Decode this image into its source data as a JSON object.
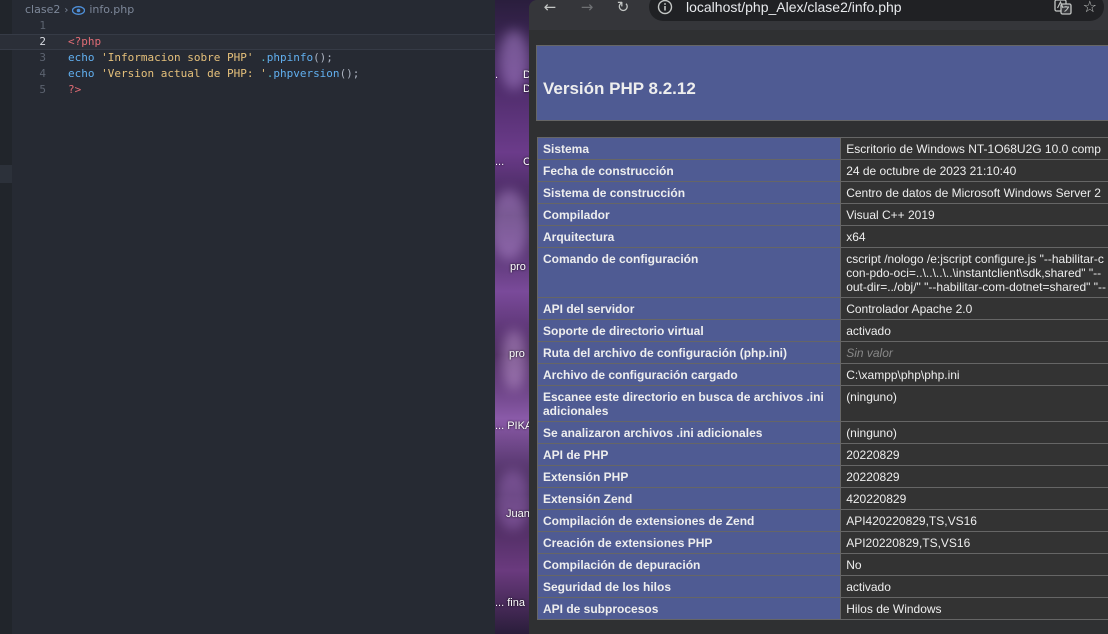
{
  "editor": {
    "breadcrumb": {
      "folder": "clase2",
      "file": "info.php"
    },
    "lines": [
      {
        "num": "1",
        "tokens": []
      },
      {
        "num": "2",
        "tokens": [
          {
            "cls": "tag",
            "t": "<?php"
          }
        ]
      },
      {
        "num": "3",
        "tokens": [
          {
            "cls": "kw",
            "t": "echo "
          },
          {
            "cls": "str",
            "t": "'Informacion sobre PHP'"
          },
          {
            "cls": "op",
            "t": " ."
          },
          {
            "cls": "fn",
            "t": "phpinfo"
          },
          {
            "cls": "punc",
            "t": "();"
          }
        ]
      },
      {
        "num": "4",
        "tokens": [
          {
            "cls": "kw",
            "t": "echo "
          },
          {
            "cls": "str",
            "t": "'Version actual de PHP: '"
          },
          {
            "cls": "op",
            "t": "."
          },
          {
            "cls": "fn",
            "t": "phpversion"
          },
          {
            "cls": "punc",
            "t": "();"
          }
        ]
      },
      {
        "num": "5",
        "tokens": [
          {
            "cls": "tag",
            "t": "?>"
          }
        ]
      }
    ],
    "active_line": "2"
  },
  "desktop": {
    "labels": [
      ".",
      "D",
      "D",
      "...",
      "C",
      "pro",
      "pro",
      "... PIKA",
      "Juan",
      "... fina"
    ]
  },
  "browser": {
    "url": "localhost/php_Alex/clase2/info.php",
    "icons": {
      "back": "back-arrow-icon",
      "forward": "forward-arrow-icon",
      "reload": "reload-icon",
      "info": "site-info-icon",
      "translate": "translate-icon",
      "bookmark": "star-icon"
    },
    "page": {
      "title": "Versión PHP 8.2.12",
      "rows": [
        {
          "key": "Sistema",
          "value": "Escritorio de Windows NT-1O68U2G 10.0 comp"
        },
        {
          "key": "Fecha de construcción",
          "value": "24 de octubre de 2023 21:10:40"
        },
        {
          "key": "Sistema de construcción",
          "value": "Centro de datos de Microsoft Windows Server 2"
        },
        {
          "key": "Compilador",
          "value": "Visual C++ 2019"
        },
        {
          "key": "Arquitectura",
          "value": "x64"
        },
        {
          "key": "Comando de configuración",
          "value": "cscript /nologo /e:jscript configure.js \"--habilitar-c\ncon-pdo-oci=..\\..\\..\\..\\instantclient\\sdk,shared\" \"--\nout-dir=../obj/\" \"--habilitar-com-dotnet=shared\" \"--"
        },
        {
          "key": "API del servidor",
          "value": "Controlador Apache 2.0"
        },
        {
          "key": "Soporte de directorio virtual",
          "value": "activado"
        },
        {
          "key": "Ruta del archivo de configuración (php.ini)",
          "value": "Sin valor",
          "novalue": true
        },
        {
          "key": "Archivo de configuración cargado",
          "value": "C:\\xampp\\php\\php.ini"
        },
        {
          "key": "Escanee este directorio en busca de archivos .ini adicionales",
          "value": "(ninguno)"
        },
        {
          "key": "Se analizaron archivos .ini adicionales",
          "value": "(ninguno)"
        },
        {
          "key": "API de PHP",
          "value": "20220829"
        },
        {
          "key": "Extensión PHP",
          "value": "20220829"
        },
        {
          "key": "Extensión Zend",
          "value": "420220829"
        },
        {
          "key": "Compilación de extensiones de Zend",
          "value": "API420220829,TS,VS16"
        },
        {
          "key": "Creación de extensiones PHP",
          "value": "API20220829,TS,VS16"
        },
        {
          "key": "Compilación de depuración",
          "value": "No"
        },
        {
          "key": "Seguridad de los hilos",
          "value": "activado"
        },
        {
          "key": "API de subprocesos",
          "value": "Hilos de Windows"
        }
      ]
    }
  }
}
